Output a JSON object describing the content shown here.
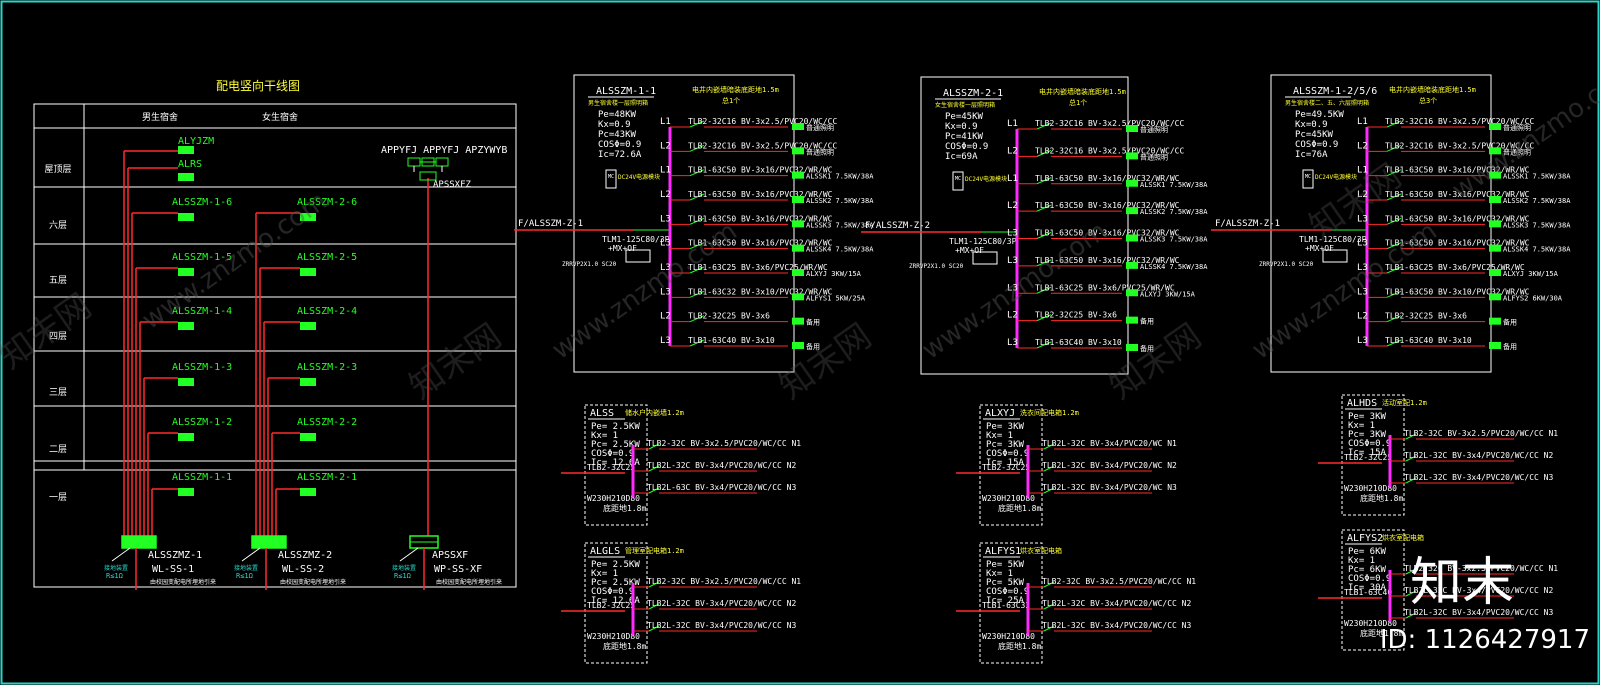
{
  "riser": {
    "title": "配电竖向干线图",
    "col_male": "男生宿舍",
    "col_female": "女生宿舍",
    "floors": [
      "屋顶层",
      "六层",
      "五层",
      "四层",
      "三层",
      "二层",
      "一层"
    ],
    "top_labels": [
      "ALYJZM",
      "ALRS"
    ],
    "male_boxes": [
      "ALSSZM-1-6",
      "ALSSZM-1-5",
      "ALSSZM-1-4",
      "ALSSZM-1-3",
      "ALSSZM-1-2",
      "ALSSZM-1-1"
    ],
    "female_boxes": [
      "ALSSZM-2-6",
      "ALSSZM-2-5",
      "ALSSZM-2-4",
      "ALSSZM-2-3",
      "ALSSZM-2-2",
      "ALSSZM-2-1"
    ],
    "roof_fire": "APPYFJ APPYFJ APZYWYB",
    "roof_fire_sub": "APSSXFZ",
    "mains": [
      {
        "name": "ALSSZMZ-1",
        "cable": "WL-SS-1",
        "note": "由校园变配电所埋地引来"
      },
      {
        "name": "ALSSZMZ-2",
        "cable": "WL-SS-2",
        "note": "由校园变配电所埋地引来"
      },
      {
        "name": "APSSXF",
        "cable": "WP-SS-XF",
        "note": "由校园变配电所埋地引来"
      }
    ],
    "ground_tag": "接地装置",
    "ground_r": "R≤1Ω"
  },
  "panels": [
    {
      "name": "ALSSZM-1-1",
      "subtitle": "男生宿舍楼一层照明箱",
      "note1": "电井内嵌墙暗装底距地1.5m",
      "note2": "总1个",
      "params": [
        "Pe=48KW",
        "Kx=0.9",
        "Pc=43KW",
        "COSΦ=0.9",
        "Ic=72.6A"
      ],
      "incoming": "F/ALSSZM-Z-1",
      "breaker": "TLM1-125C80/3P",
      "breaker2": "+MX+OF",
      "spd": "ZRRVP2X1.0 SC20",
      "mc": "MC",
      "mc_note": "DC24V电源模块",
      "circuits": [
        {
          "ph": "L1",
          "spec": "TLB2-32C16 BV-3x2.5/PVC20/WC/CC",
          "load": "普通照明"
        },
        {
          "ph": "L2",
          "spec": "TLB2-32C16 BV-3x2.5/PVC20/WC/CC",
          "load": "普通照明"
        },
        {
          "ph": "L1",
          "spec": "TLB1-63C50 BV-3x16/PVC32/WR/WC",
          "load": "ALSSK1 7.5KW/38A"
        },
        {
          "ph": "L2",
          "spec": "TLB1-63C50 BV-3x16/PVC32/WR/WC",
          "load": "ALSSK2 7.5KW/38A"
        },
        {
          "ph": "L3",
          "spec": "TLB1-63C50 BV-3x16/PVC32/WR/WC",
          "load": "ALSSK3 7.5KW/38A"
        },
        {
          "ph": "L3",
          "spec": "TLB1-63C50 BV-3x16/PVC32/WR/WC",
          "load": "ALSSK4 7.5KW/38A"
        },
        {
          "ph": "L3",
          "spec": "TLB1-63C25 BV-3x6/PVC25/WR/WC",
          "load": "ALXYJ 3KW/15A"
        },
        {
          "ph": "L3",
          "spec": "TLB1-63C32 BV-3x10/PVC32/WR/WC",
          "load": "ALFYS1 5KW/25A"
        },
        {
          "ph": "L2",
          "spec": "TLB2-32C25 BV-3x6",
          "load": "备用"
        },
        {
          "ph": "L3",
          "spec": "TLB1-63C40 BV-3x10",
          "load": "备用"
        }
      ]
    },
    {
      "name": "ALSSZM-2-1",
      "subtitle": "女生宿舍楼一层照明箱",
      "note1": "电井内嵌墙暗装底距地1.5m",
      "note2": "总1个",
      "params": [
        "Pe=45KW",
        "Kx=0.9",
        "Pc=41KW",
        "COSΦ=0.9",
        "Ic=69A"
      ],
      "incoming": "F/ALSSZM-Z-2",
      "breaker": "TLM1-125C80/3P",
      "breaker2": "+MX+OF",
      "spd": "ZRRVP2X1.0 SC20",
      "mc": "MC",
      "mc_note": "DC24V电源模块",
      "circuits": [
        {
          "ph": "L1",
          "spec": "TLB2-32C16 BV-3x2.5/PVC20/WC/CC",
          "load": "普通照明"
        },
        {
          "ph": "L2",
          "spec": "TLB2-32C16 BV-3x2.5/PVC20/WC/CC",
          "load": "普通照明"
        },
        {
          "ph": "L1",
          "spec": "TLB1-63C50 BV-3x16/PVC32/WR/WC",
          "load": "ALSSK1 7.5KW/38A"
        },
        {
          "ph": "L2",
          "spec": "TLB1-63C50 BV-3x16/PVC32/WR/WC",
          "load": "ALSSK2 7.5KW/38A"
        },
        {
          "ph": "L3",
          "spec": "TLB1-63C50 BV-3x16/PVC32/WR/WC",
          "load": "ALSSK3 7.5KW/38A"
        },
        {
          "ph": "L3",
          "spec": "TLB1-63C50 BV-3x16/PVC32/WR/WC",
          "load": "ALSSK4 7.5KW/38A"
        },
        {
          "ph": "L3",
          "spec": "TLB1-63C25 BV-3x6/PVC25/WR/WC",
          "load": "ALXYJ 3KW/15A"
        },
        {
          "ph": "L2",
          "spec": "TLB2-32C25 BV-3x6",
          "load": "备用"
        },
        {
          "ph": "L3",
          "spec": "TLB1-63C40 BV-3x10",
          "load": "备用"
        }
      ]
    },
    {
      "name": "ALSSZM-1-2/5/6",
      "subtitle": "男生宿舍楼二、五、六层照明箱",
      "note1": "电井内嵌墙暗装底距地1.5m",
      "note2": "总3个",
      "params": [
        "Pe=49.5KW",
        "Kx=0.9",
        "Pc=45KW",
        "COSΦ=0.9",
        "Ic=76A"
      ],
      "incoming": "F/ALSSZM-Z-1",
      "breaker": "TLM1-125C80/3P",
      "breaker2": "+MX+OF",
      "spd": "ZRRVP2X1.0 SC20",
      "mc": "MC",
      "mc_note": "DC24V电源模块",
      "circuits": [
        {
          "ph": "L1",
          "spec": "TLB2-32C16 BV-3x2.5/PVC20/WC/CC",
          "load": "普通照明"
        },
        {
          "ph": "L2",
          "spec": "TLB2-32C16 BV-3x2.5/PVC20/WC/CC",
          "load": "普通照明"
        },
        {
          "ph": "L1",
          "spec": "TLB1-63C50 BV-3x16/PVC32/WR/WC",
          "load": "ALSSK1 7.5KW/38A"
        },
        {
          "ph": "L2",
          "spec": "TLB1-63C50 BV-3x16/PVC32/WR/WC",
          "load": "ALSSK2 7.5KW/38A"
        },
        {
          "ph": "L3",
          "spec": "TLB1-63C50 BV-3x16/PVC32/WR/WC",
          "load": "ALSSK3 7.5KW/38A"
        },
        {
          "ph": "L3",
          "spec": "TLB1-63C50 BV-3x16/PVC32/WR/WC",
          "load": "ALSSK4 7.5KW/38A"
        },
        {
          "ph": "L3",
          "spec": "TLB1-63C25 BV-3x6/PVC25/WR/WC",
          "load": "ALXYJ 3KW/15A"
        },
        {
          "ph": "L3",
          "spec": "TLB1-63C50 BV-3x10/PVC32/WR/WC",
          "load": "ALFYS2 6KW/30A"
        },
        {
          "ph": "L2",
          "spec": "TLB2-32C25 BV-3x6",
          "load": "备用"
        },
        {
          "ph": "L3",
          "spec": "TLB1-63C40 BV-3x10",
          "load": "备用"
        }
      ]
    }
  ],
  "small_boxes": [
    {
      "name": "ALSS",
      "note": "储水户内嵌墙1.2m",
      "params": [
        "Pe= 2.5KW",
        "Kx= 1",
        "Pc= 2.5KW",
        "COSΦ=0.9",
        "Ic= 12.6A"
      ],
      "main": "TLB2-32C25",
      "meter": "W230H210D80",
      "meter2": "底距地1.8m",
      "circuits": [
        "TLB2-32C BV-3x2.5/PVC20/WC/CC N1",
        "TLB2L-32C BV-3x4/PVC20/WC/CC N2",
        "TLB2L-63C BV-3x4/PVC20/WC/CC N3"
      ]
    },
    {
      "name": "ALXYJ",
      "note": "洗衣间配电箱1.2m",
      "params": [
        "Pe= 3KW",
        "Kx= 1",
        "Pc= 3KW",
        "COSΦ=0.9",
        "Ic= 15A"
      ],
      "main": "TLB2-32C25",
      "meter": "W230H210D80",
      "meter2": "底距地1.8m",
      "circuits": [
        "TLB2L-32C BV-3x4/PVC20/WC N1",
        "TLB2L-32C BV-3x4/PVC20/WC N2",
        "TLB2L-32C BV-3x4/PVC20/WC N3"
      ]
    },
    {
      "name": "ALHDS",
      "note": "活动室配1.2m",
      "params": [
        "Pe= 3KW",
        "Kx= 1",
        "Pc= 3KW",
        "COSΦ=0.9",
        "Ic= 15A"
      ],
      "main": "TLB2-32C25",
      "meter": "W230H210D80",
      "meter2": "底距地1.8m",
      "circuits": [
        "TLB2-32C BV-3x2.5/PVC20/WC/CC N1",
        "TLB2L-32C BV-3x4/PVC20/WC/CC N2",
        "TLB2L-32C BV-3x4/PVC20/WC/CC N3"
      ]
    },
    {
      "name": "ALGLS",
      "note": "管理室配电箱1.2m",
      "params": [
        "Pe= 2.5KW",
        "Kx= 1",
        "Pc= 2.5KW",
        "COSΦ=0.9",
        "Ic= 12.6A"
      ],
      "main": "TLB2-32C25",
      "meter": "W230H210D80",
      "meter2": "底距地1.8m",
      "circuits": [
        "TLB2-32C BV-3x2.5/PVC20/WC/CC N1",
        "TLB2L-32C BV-3x4/PVC20/WC/CC N2",
        "TLB2L-32C BV-3x4/PVC20/WC/CC N3"
      ]
    },
    {
      "name": "ALFYS1",
      "note": "烘衣室配电箱",
      "params": [
        "Pe= 5KW",
        "Kx= 1",
        "Pc= 5KW",
        "COSΦ=0.9",
        "Ic= 25A"
      ],
      "main": "TLB1-63C32",
      "meter": "W230H210D80",
      "meter2": "底距地1.8m",
      "circuits": [
        "TLB2-32C BV-3x2.5/PVC20/WC/CC N1",
        "TLB2L-32C BV-3x4/PVC20/WC/CC N2",
        "TLB2L-32C BV-3x4/PVC20/WC/CC N3"
      ]
    },
    {
      "name": "ALFYS2",
      "note": "烘衣室配电箱",
      "params": [
        "Pe= 6KW",
        "Kx= 1",
        "Pc= 6KW",
        "COSΦ=0.9",
        "Ic= 30A"
      ],
      "main": "TLB1-63C40",
      "meter": "W230H210D80",
      "meter2": "底距地1.8m",
      "circuits": [
        "TLB2-32C BV-3x2.5/PVC20/WC/CC N1",
        "TLB2L-32C BV-3x4/PVC20/WC/CC N2",
        "TLB2L-32C BV-3x4/PVC20/WC/CC N3"
      ]
    }
  ],
  "watermark": {
    "site": "www.znzmo.com",
    "brand": "知末网",
    "logo": "知末",
    "id": "ID: 1126427917"
  }
}
